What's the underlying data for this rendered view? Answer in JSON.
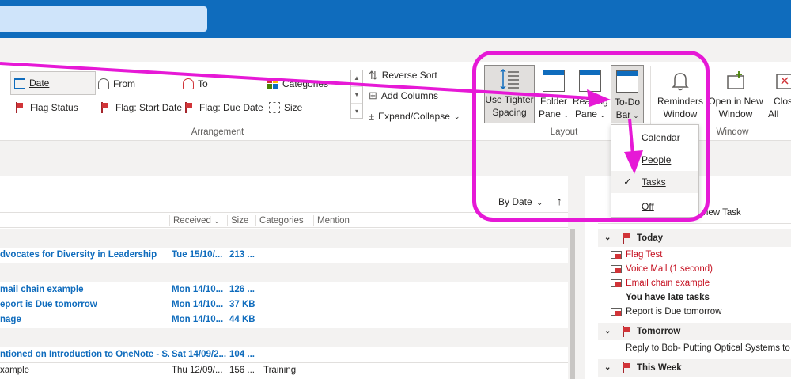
{
  "ribbon": {
    "arrangement": {
      "date": "Date",
      "from": "From",
      "to": "To",
      "categories": "Categories",
      "flag_status": "Flag Status",
      "flag_start": "Flag: Start Date",
      "flag_due": "Flag: Due Date",
      "size": "Size",
      "reverse_sort": "Reverse Sort",
      "add_columns": "Add Columns",
      "expand_collapse": "Expand/Collapse",
      "group_label": "Arrangement"
    },
    "layout": {
      "tighter_line1": "Use Tighter",
      "tighter_line2": "Spacing",
      "folder_line1": "Folder",
      "folder_line2": "Pane",
      "reading_line1": "Reading",
      "reading_line2": "Pane",
      "todo_line1": "To-Do",
      "todo_line2": "Bar",
      "group_label": "Layout"
    },
    "window": {
      "reminders_line1": "Reminders",
      "reminders_line2": "Window",
      "open_line1": "Open in New",
      "open_line2": "Window",
      "close_line1": "Clos",
      "close_line2": "All Ite",
      "group_label": "Window"
    }
  },
  "todo_dropdown": {
    "items": [
      "Calendar",
      "People",
      "Tasks",
      "Off"
    ],
    "checked": "Tasks"
  },
  "mail": {
    "sort_label": "By Date",
    "columns": [
      "Received",
      "Size",
      "Categories",
      "Mention"
    ],
    "rows": [
      {
        "subject": "dvocates for Diversity in Leadership",
        "received": "Tue 15/10/...",
        "size": "213 ...",
        "categories": "",
        "unread": true
      },
      {
        "subject": "mail chain example",
        "received": "Mon 14/10...",
        "size": "126 ...",
        "categories": "",
        "unread": true
      },
      {
        "subject": "eport is Due tomorrow",
        "received": "Mon 14/10...",
        "size": "37 KB",
        "categories": "",
        "unread": true
      },
      {
        "subject": "nage",
        "received": "Mon 14/10...",
        "size": "44 KB",
        "categories": "",
        "unread": true
      },
      {
        "subject": "ntioned on Introduction to OneNote - S...",
        "received": "Sat 14/09/2...",
        "size": "104 ...",
        "categories": "",
        "unread": true
      },
      {
        "subject": "xample",
        "received": "Thu 12/09/...",
        "size": "156 ...",
        "categories": "Training",
        "unread": false
      }
    ]
  },
  "todo": {
    "new_task": "new Task",
    "groups": {
      "today": "Today",
      "tomorrow": "Tomorrow",
      "this_week": "This Week"
    },
    "today_items": [
      "Flag Test",
      "Voice Mail (1 second)",
      "Email chain example"
    ],
    "late_note": "You have late tasks",
    "today_extra": "Report is Due tomorrow",
    "tomorrow_items": [
      "Reply to Bob- Putting Optical Systems to"
    ]
  },
  "colors": {
    "title_bar": "#0f6cbd",
    "highlight": "#e619d6",
    "unread": "#0f6cbd",
    "flag": "#d13438"
  }
}
